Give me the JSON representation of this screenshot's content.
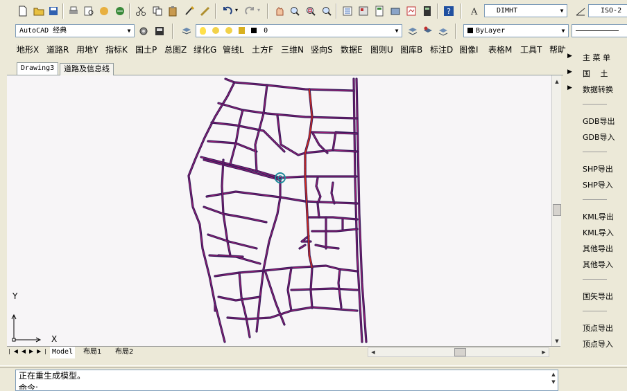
{
  "toolbar": {
    "dim_style": "DIMHT",
    "iso_style": "ISO-2"
  },
  "workspace": {
    "value": "AutoCAD 经典"
  },
  "layer": {
    "value": "0"
  },
  "color": {
    "value": "ByLayer"
  },
  "menu": [
    {
      "label": "地形X"
    },
    {
      "label": "道路R"
    },
    {
      "label": "用地Y"
    },
    {
      "label": "指标K"
    },
    {
      "label": "国土P"
    },
    {
      "label": "总图Z"
    },
    {
      "label": "绿化G"
    },
    {
      "label": "管线L"
    },
    {
      "label": "土方F"
    },
    {
      "label": "三维N"
    },
    {
      "label": "竖向S"
    },
    {
      "label": "数据E"
    },
    {
      "label": "图则U"
    },
    {
      "label": "图库B"
    },
    {
      "label": "标注D"
    },
    {
      "label": "图像I"
    },
    {
      "label": "表格M"
    },
    {
      "label": "工具T"
    },
    {
      "label": "帮助"
    }
  ],
  "doc_tabs": [
    {
      "label": "Drawing3"
    },
    {
      "label": "道路及信息线"
    }
  ],
  "ucs": {
    "y": "Y",
    "x": "X"
  },
  "layout_tabs": [
    {
      "label": "Model"
    },
    {
      "label": "布局1"
    },
    {
      "label": "布局2"
    }
  ],
  "right_panel": {
    "items": [
      {
        "label": "主 菜 单",
        "arrow": "▶"
      },
      {
        "label": "国　 土",
        "arrow": "▶"
      },
      {
        "label": "数据转换",
        "arrow": "▶"
      },
      {
        "label": "GDB导出"
      },
      {
        "label": "GDB导入"
      },
      {
        "label": "SHP导出"
      },
      {
        "label": "SHP导入"
      },
      {
        "label": "KML导出"
      },
      {
        "label": "KML导入"
      },
      {
        "label": "其他导出"
      },
      {
        "label": "其他导入"
      },
      {
        "label": "国矢导出"
      },
      {
        "label": "顶点导出"
      },
      {
        "label": "顶点导入"
      }
    ]
  },
  "command": {
    "line1": "正在重生成模型。",
    "line2": "命令:"
  },
  "colors": {
    "road": "#3a1a5c",
    "road_inner": "#b2207a",
    "highlight": "#d42a1a",
    "canvas_bg": "#f7f5f7"
  }
}
